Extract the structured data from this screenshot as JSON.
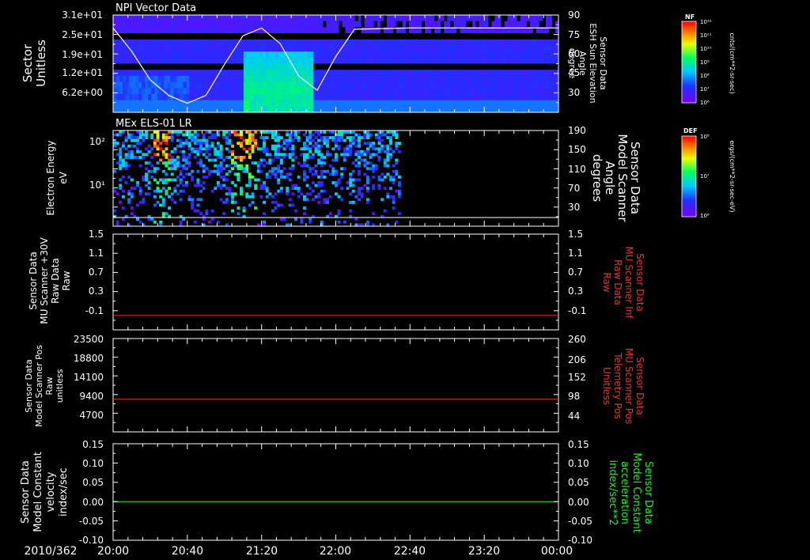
{
  "date_label": "2010/362",
  "x_ticks": [
    "20:00",
    "20:40",
    "21:20",
    "22:00",
    "22:40",
    "23:20",
    "00:00"
  ],
  "colors": {
    "background": "#000000",
    "axis": "#ffffff",
    "red_trace": "#ff2020",
    "green_trace": "#20ff20",
    "red_label": "#ff2a2a",
    "green_label": "#22ee22"
  },
  "panels": [
    {
      "title": "NPI Vector Data",
      "left_label": [
        "Sector",
        "Unitless"
      ],
      "left_ticks": [
        "3.1e+01",
        "2.5e+01",
        "1.9e+01",
        "1.2e+01",
        "6.2e+00"
      ],
      "right_label": [
        "Sensor Data",
        "ESH Sun Elevation",
        "Angle",
        "degree"
      ],
      "right_ticks": [
        "90",
        "75",
        "60",
        "45",
        "30"
      ],
      "colorbar": {
        "title": "NF",
        "unit": "cnts/(cm**2-sr-sec)",
        "ticks": [
          "10¹²",
          "10¹¹",
          "10¹⁰",
          "10⁹",
          "10⁸",
          "10⁷",
          "10⁶"
        ]
      }
    },
    {
      "title": "MEx ELS-01 LR",
      "left_label": [
        "Electron Energy",
        "eV"
      ],
      "left_ticks": [
        "10²",
        "10¹"
      ],
      "right_label": [
        "Sensor Data",
        "Model Scanner",
        "Angle",
        "degrees"
      ],
      "right_ticks": [
        "190",
        "150",
        "110",
        "70",
        "30"
      ],
      "colorbar": {
        "title": "DEF",
        "unit": "ergs/(cm**2-sr-sec-eV)",
        "ticks": [
          "10⁸",
          "10⁷",
          "10⁶"
        ]
      }
    },
    {
      "left_label": [
        "Sensor Data",
        "MU Scanner +30V",
        "Raw Data",
        "Raw"
      ],
      "left_ticks": [
        "1.5",
        "1.1",
        "0.7",
        "0.3",
        "-0.1"
      ],
      "right_label": [
        "Sensor Data",
        "MU Scanner Inf",
        "Raw Data",
        "Raw"
      ],
      "right_ticks": [
        "1.5",
        "1.1",
        "0.7",
        "0.3",
        "-0.1"
      ]
    },
    {
      "left_label": [
        "Sensor Data",
        "Model Scanner Pos",
        "Raw",
        "unitless"
      ],
      "left_ticks": [
        "23500",
        "18800",
        "14100",
        "9400",
        "4700"
      ],
      "right_label": [
        "Sensor Data",
        "MU Scanner Pos",
        "Telemetry Pos",
        "Unitless"
      ],
      "right_ticks": [
        "260",
        "206",
        "152",
        "98",
        "44"
      ]
    },
    {
      "left_label": [
        "Sensor Data",
        "Model Constant",
        "velocity",
        "index/sec"
      ],
      "left_ticks": [
        "0.15",
        "0.10",
        "0.05",
        "0.00",
        "-0.05",
        "-0.10"
      ],
      "right_label": [
        "Sensor Data",
        "Model Constant",
        "acceleration",
        "index/sec**2"
      ],
      "right_ticks": [
        "0.15",
        "0.10",
        "0.05",
        "0.00",
        "-0.05",
        "-0.10"
      ]
    }
  ],
  "chart_data": [
    {
      "type": "heatmap",
      "title": "NPI Vector Data",
      "x": [
        "20:00",
        "20:40",
        "21:20",
        "22:00",
        "22:40",
        "23:20",
        "00:00"
      ],
      "ylabel": "Sector Unitless",
      "y_ticks": [
        "3.1e+01",
        "2.5e+01",
        "1.9e+01",
        "1.2e+01",
        "6.2e+00"
      ],
      "colorbar": "NF cnts/(cm**2-sr-sec)",
      "overlay_line": {
        "name": "ESH Sun Elevation Angle",
        "axis": "right",
        "ylim": [
          15,
          90
        ],
        "x": [
          "20:00",
          "20:10",
          "20:20",
          "20:30",
          "20:40",
          "20:50",
          "21:00",
          "21:10",
          "21:20",
          "21:30",
          "21:40",
          "21:50",
          "22:00",
          "22:10",
          "22:40",
          "23:20",
          "00:00"
        ],
        "values": [
          80,
          62,
          40,
          28,
          22,
          28,
          52,
          74,
          80,
          68,
          43,
          32,
          58,
          79,
          80,
          80,
          80
        ]
      }
    },
    {
      "type": "heatmap",
      "title": "MEx ELS-01 LR",
      "ylabel": "Electron Energy eV",
      "y_ticks": [
        "10²",
        "10¹"
      ],
      "colorbar": "DEF ergs/(cm**2-sr-sec-eV)",
      "data_extent": [
        "20:00",
        "22:35"
      ],
      "overlay_line": {
        "axis": "right",
        "ylim": [
          0,
          190
        ],
        "values": [
          10,
          10
        ]
      }
    },
    {
      "type": "line",
      "left_ylim": [
        -0.3,
        1.5
      ],
      "series": [
        {
          "values": [
            -0.03,
            -0.03
          ],
          "x": [
            "20:00",
            "00:00"
          ]
        }
      ]
    },
    {
      "type": "line",
      "left_ylim": [
        0,
        23500
      ],
      "series": [
        {
          "values": [
            8200,
            8200
          ],
          "x": [
            "20:00",
            "00:00"
          ]
        }
      ]
    },
    {
      "type": "line",
      "left_ylim": [
        -0.1,
        0.15
      ],
      "series": [
        {
          "values": [
            0.0,
            0.0
          ],
          "x": [
            "20:00",
            "00:00"
          ]
        }
      ]
    }
  ]
}
